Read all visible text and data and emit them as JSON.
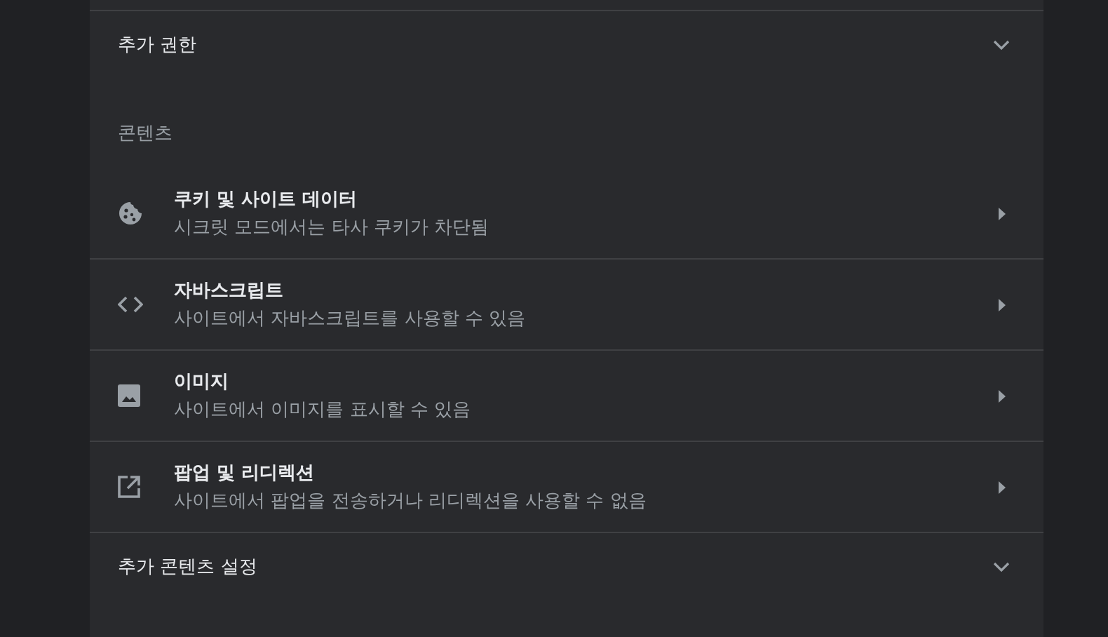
{
  "expand_rows_top": [
    {
      "label": "추가 권한"
    }
  ],
  "section": {
    "title": "콘텐츠",
    "items": [
      {
        "kind": "cookie",
        "title": "쿠키 및 사이트 데이터",
        "subtitle": "시크릿 모드에서는 타사 쿠키가 차단됨"
      },
      {
        "kind": "code",
        "title": "자바스크립트",
        "subtitle": "사이트에서 자바스크립트를 사용할 수 있음"
      },
      {
        "kind": "image",
        "title": "이미지",
        "subtitle": "사이트에서 이미지를 표시할 수 있음"
      },
      {
        "kind": "popup",
        "title": "팝업 및 리디렉션",
        "subtitle": "사이트에서 팝업을 전송하거나 리디렉션을 사용할 수 없음"
      }
    ]
  },
  "expand_rows_bottom": [
    {
      "label": "추가 콘텐츠 설정"
    }
  ]
}
